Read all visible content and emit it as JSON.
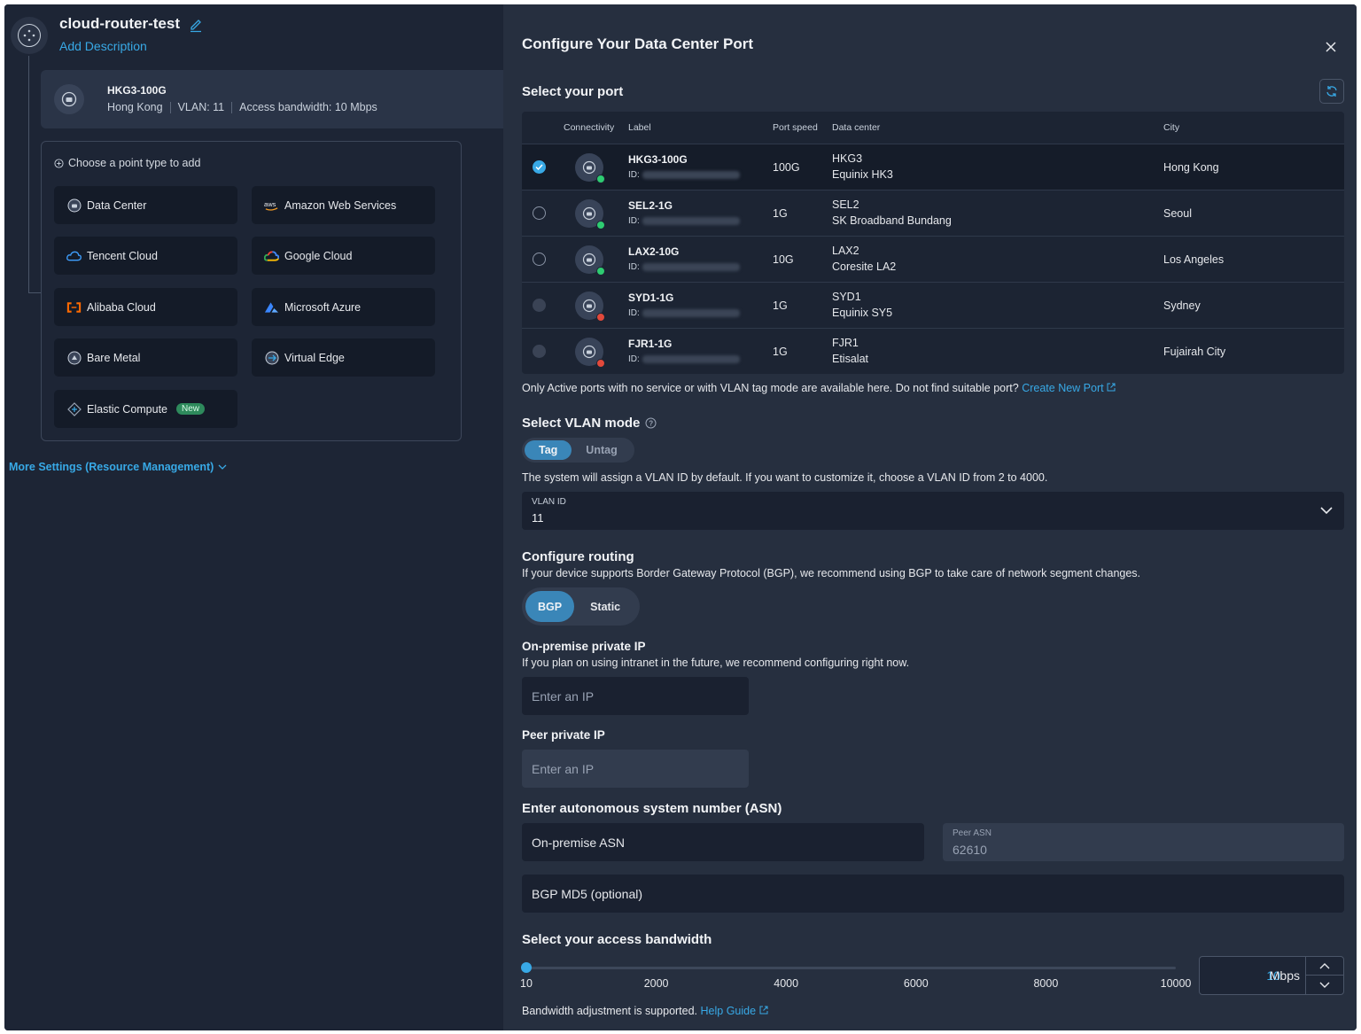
{
  "router": {
    "title": "cloud-router-test",
    "add_description": "Add Description"
  },
  "current_port": {
    "name": "HKG3-100G",
    "location": "Hong Kong",
    "vlan": "VLAN: 11",
    "bandwidth": "Access bandwidth: 10 Mbps"
  },
  "chooser": {
    "header": "Choose a point type to add",
    "types": [
      {
        "label": "Data Center",
        "icon": "data-center-icon"
      },
      {
        "label": "Amazon Web Services",
        "icon": "aws-icon"
      },
      {
        "label": "Tencent Cloud",
        "icon": "tencent-cloud-icon"
      },
      {
        "label": "Google Cloud",
        "icon": "google-cloud-icon"
      },
      {
        "label": "Alibaba Cloud",
        "icon": "alibaba-cloud-icon"
      },
      {
        "label": "Microsoft Azure",
        "icon": "azure-icon"
      },
      {
        "label": "Bare Metal",
        "icon": "bare-metal-icon"
      },
      {
        "label": "Virtual Edge",
        "icon": "virtual-edge-icon"
      },
      {
        "label": "Elastic Compute",
        "icon": "elastic-compute-icon",
        "badge": "New"
      }
    ]
  },
  "more_settings": "More Settings (Resource Management)",
  "panel": {
    "title": "Configure Your Data Center Port",
    "select_port": "Select your port",
    "columns": {
      "connectivity": "Connectivity",
      "label": "Label",
      "port_speed": "Port speed",
      "data_center": "Data center",
      "city": "City"
    },
    "ports": [
      {
        "label": "HKG3-100G",
        "id_prefix": "ID:",
        "speed": "100G",
        "dc_code": "HKG3",
        "dc_name": "Equinix HK3",
        "city": "Hong Kong",
        "status": "green",
        "radio": "checked"
      },
      {
        "label": "SEL2-1G",
        "id_prefix": "ID:",
        "speed": "1G",
        "dc_code": "SEL2",
        "dc_name": "SK Broadband Bundang",
        "city": "Seoul",
        "status": "green",
        "radio": "empty"
      },
      {
        "label": "LAX2-10G",
        "id_prefix": "ID:",
        "speed": "10G",
        "dc_code": "LAX2",
        "dc_name": "Coresite LA2",
        "city": "Los Angeles",
        "status": "green",
        "radio": "empty"
      },
      {
        "label": "SYD1-1G",
        "id_prefix": "ID:",
        "speed": "1G",
        "dc_code": "SYD1",
        "dc_name": "Equinix SY5",
        "city": "Sydney",
        "status": "red",
        "radio": "disabled"
      },
      {
        "label": "FJR1-1G",
        "id_prefix": "ID:",
        "speed": "1G",
        "dc_code": "FJR1",
        "dc_name": "Etisalat",
        "city": "Fujairah City",
        "status": "red",
        "radio": "disabled"
      }
    ],
    "note": "Only Active ports with no service or with VLAN tag mode are available here. Do not find suitable port?",
    "create_port": "Create New Port",
    "vlan_mode": {
      "title": "Select VLAN mode",
      "options": [
        "Tag",
        "Untag"
      ],
      "selected": "Tag",
      "hint": "The system will assign a VLAN ID by default. If you want to customize it, choose a VLAN ID from 2 to 4000."
    },
    "vlan_id": {
      "label": "VLAN ID",
      "value": "11"
    },
    "routing": {
      "title": "Configure routing",
      "hint": "If your device supports Border Gateway Protocol (BGP), we recommend using BGP to take care of network segment changes.",
      "options": [
        "BGP",
        "Static"
      ],
      "selected": "BGP"
    },
    "onprem_ip": {
      "title": "On-premise private IP",
      "hint": "If you plan on using intranet in the future, we recommend configuring right now.",
      "placeholder": "Enter an IP"
    },
    "peer_ip": {
      "title": "Peer private IP",
      "placeholder": "Enter an IP"
    },
    "asn": {
      "title": "Enter autonomous system number (ASN)",
      "onprem_placeholder": "On-premise ASN",
      "peer_label": "Peer ASN",
      "peer_value": "62610",
      "md5_placeholder": "BGP MD5 (optional)"
    },
    "bandwidth": {
      "title": "Select your access bandwidth",
      "ticks": [
        "10",
        "2000",
        "4000",
        "6000",
        "8000",
        "10000"
      ],
      "value": "10",
      "unit": "Mbps",
      "slider_fraction": 0,
      "note": "Bandwidth adjustment is supported.",
      "help": "Help Guide"
    }
  },
  "colors": {
    "accent": "#38a9e6",
    "active": "#2ecc71",
    "inactive": "#e2493b",
    "panel": "#262f3f",
    "bg": "#1d2535"
  }
}
